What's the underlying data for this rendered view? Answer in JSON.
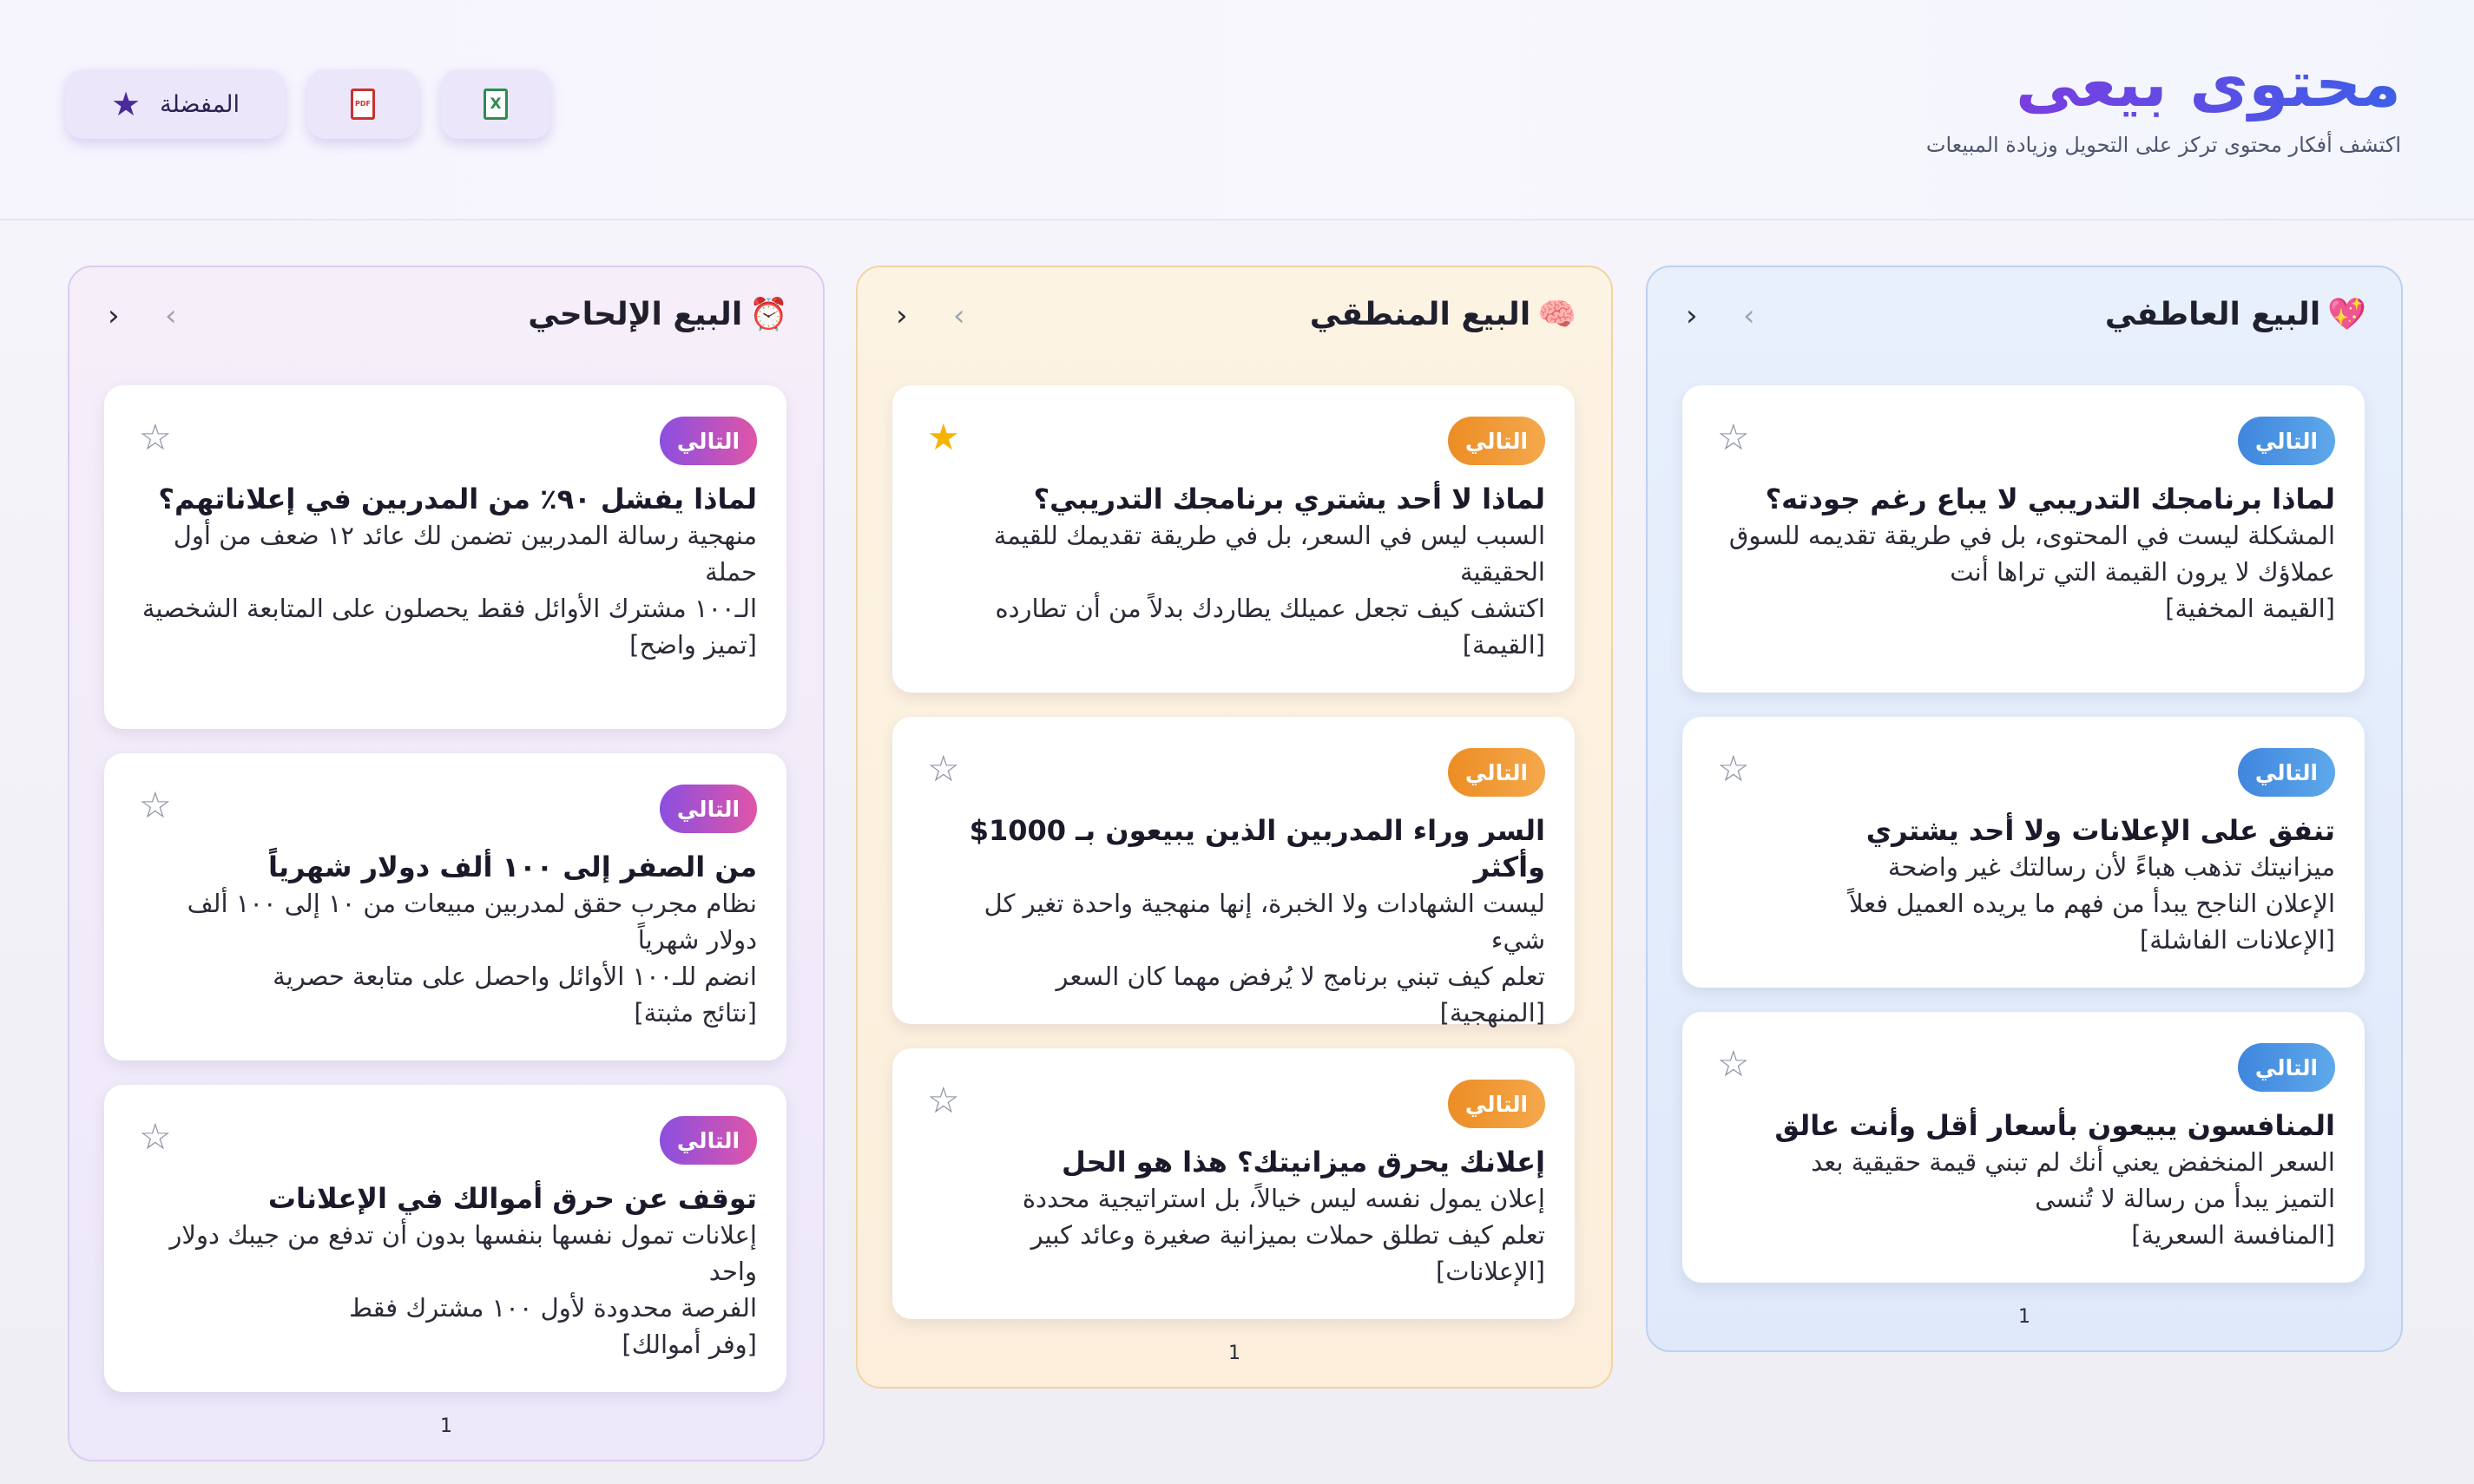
{
  "header": {
    "title": "محتوى بيعى",
    "subtitle": "اكتشف أفكار محتوى تركز على التحويل وزيادة المبيعات",
    "favorites_label": "المفضلة"
  },
  "columns": [
    {
      "emoji": "💖",
      "title": "البيع العاطفي",
      "prev": "‹",
      "next": "›",
      "page": "1",
      "badge_color": "#4a90e2",
      "cards": [
        {
          "badge": "التالي",
          "starred": false,
          "title": "لماذا برنامجك التدريبي لا يباع رغم جودته؟",
          "lines": [
            "المشكلة ليست في المحتوى، بل في طريقة تقديمه للسوق",
            "عملاؤك لا يرون القيمة التي تراها أنت",
            "[القيمة المخفية]"
          ]
        },
        {
          "badge": "التالي",
          "starred": false,
          "title": "تنفق على الإعلانات ولا أحد يشتري",
          "lines": [
            "ميزانيتك تذهب هباءً لأن رسالتك غير واضحة",
            "الإعلان الناجح يبدأ من فهم ما يريده العميل فعلاً",
            "[الإعلانات الفاشلة]"
          ]
        },
        {
          "badge": "التالي",
          "starred": false,
          "title": "المنافسون يبيعون بأسعار أقل وأنت عالق",
          "lines": [
            "السعر المنخفض يعني أنك لم تبني قيمة حقيقية بعد",
            "التميز يبدأ من رسالة لا تُنسى",
            "[المنافسة السعرية]"
          ]
        }
      ]
    },
    {
      "emoji": "🧠",
      "title": "البيع المنطقي",
      "prev": "‹",
      "next": "›",
      "page": "1",
      "badge_color": "#f0922f",
      "cards": [
        {
          "badge": "التالي",
          "starred": true,
          "title": "لماذا لا أحد يشتري برنامجك التدريبي؟",
          "lines": [
            "السبب ليس في السعر، بل في طريقة تقديمك للقيمة الحقيقية",
            "اكتشف كيف تجعل عميلك يطاردك بدلاً من أن تطارده",
            "[القيمة]"
          ]
        },
        {
          "badge": "التالي",
          "starred": false,
          "title": "السر وراء المدربين الذين يبيعون بـ 1000$ وأكثر",
          "lines": [
            "ليست الشهادات ولا الخبرة، إنها منهجية واحدة تغير كل شيء",
            "تعلم كيف تبني برنامج لا يُرفض مهما كان السعر",
            "[المنهجية]"
          ]
        },
        {
          "badge": "التالي",
          "starred": false,
          "title": "إعلانك يحرق ميزانيتك؟ هذا هو الحل",
          "lines": [
            "إعلان يمول نفسه ليس خيالاً، بل استراتيجية محددة",
            "تعلم كيف تطلق حملات بميزانية صغيرة وعائد كبير",
            "[الإعلانات]"
          ]
        }
      ]
    },
    {
      "emoji": "⏰",
      "title": "البيع الإلحاحي",
      "prev": "‹",
      "next": "›",
      "page": "1",
      "badge_color": "#a455d8",
      "cards": [
        {
          "badge": "التالي",
          "starred": false,
          "title": "لماذا يفشل ٩٠٪ من المدربين في إعلاناتهم؟",
          "lines": [
            "منهجية رسالة المدربين تضمن لك عائد ١٢ ضعف من أول حملة",
            "الـ١٠٠ مشترك الأوائل فقط يحصلون على المتابعة الشخصية",
            "[تميز واضح]"
          ]
        },
        {
          "badge": "التالي",
          "starred": false,
          "title": "من الصفر إلى ١٠٠ ألف دولار شهرياً",
          "lines": [
            "نظام مجرب حقق لمدربين مبيعات من ١٠ إلى ١٠٠ ألف دولار شهرياً",
            "انضم للـ١٠٠ الأوائل واحصل على متابعة حصرية",
            "[نتائج مثبتة]"
          ]
        },
        {
          "badge": "التالي",
          "starred": false,
          "title": "توقف عن حرق أموالك في الإعلانات",
          "lines": [
            "إعلانات تمول نفسها بنفسها بدون أن تدفع من جيبك دولار واحد",
            "الفرصة محدودة لأول ١٠٠ مشترك فقط",
            "[وفر أموالك]"
          ]
        }
      ]
    }
  ],
  "icons": {
    "favorites": "star-icon",
    "pdf": "pdf-file-icon",
    "excel": "excel-file-icon",
    "star_filled_color": "#f4b400",
    "star_empty_color": "#8a90a4"
  }
}
